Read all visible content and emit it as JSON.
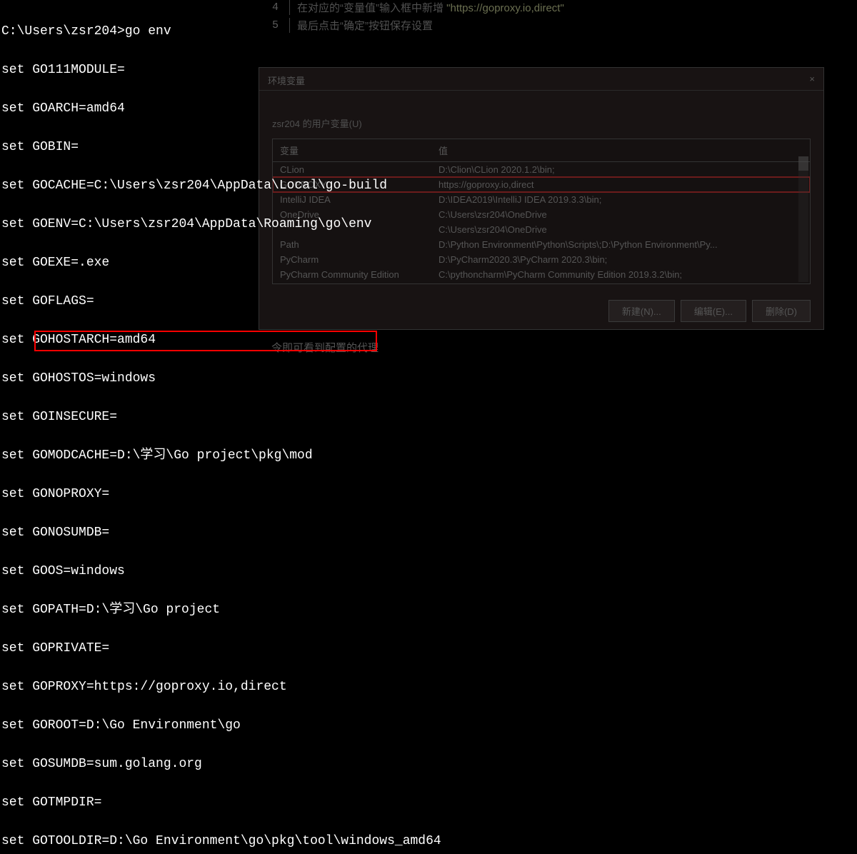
{
  "terminal": {
    "prompt": "C:\\Users\\zsr204>go env",
    "lines": [
      "set GO111MODULE=",
      "set GOARCH=amd64",
      "set GOBIN=",
      "set GOCACHE=C:\\Users\\zsr204\\AppData\\Local\\go-build",
      "set GOENV=C:\\Users\\zsr204\\AppData\\Roaming\\go\\env",
      "set GOEXE=.exe",
      "set GOFLAGS=",
      "set GOHOSTARCH=amd64",
      "set GOHOSTOS=windows",
      "set GOINSECURE=",
      "set GOMODCACHE=D:\\学习\\Go project\\pkg\\mod",
      "set GONOPROXY=",
      "set GONOSUMDB=",
      "set GOOS=windows",
      "set GOPATH=D:\\学习\\Go project",
      "set GOPRIVATE=",
      "set GOPROXY=https://goproxy.io,direct",
      "set GOROOT=D:\\Go Environment\\go",
      "set GOSUMDB=sum.golang.org",
      "set GOTMPDIR=",
      "set GOTOOLDIR=D:\\Go Environment\\go\\pkg\\tool\\windows_amd64"
    ]
  },
  "bg": {
    "step4num": "4",
    "step4": "在对应的“变量值”输入框中新增 ",
    "step4hl": "\"https://goproxy.io,direct\"",
    "step5num": "5",
    "step5": "最后点击“确定”按钮保存设置",
    "caption": "令即可看到配置的代理"
  },
  "dialog": {
    "title": "环境变量",
    "subtitle": "zsr204 的用户变量(U)",
    "close": "×",
    "headers": {
      "var": "变量",
      "val": "值"
    },
    "rows": [
      {
        "var": "CLion",
        "val": "D:\\Clion\\CLion 2020.1.2\\bin;"
      },
      {
        "var": "GOPROXY",
        "val": "https://goproxy.io,direct"
      },
      {
        "var": "IntelliJ IDEA",
        "val": "D:\\IDEA2019\\IntelliJ IDEA 2019.3.3\\bin;"
      },
      {
        "var": "OneDrive",
        "val": "C:\\Users\\zsr204\\OneDrive"
      },
      {
        "var": "",
        "val": "C:\\Users\\zsr204\\OneDrive"
      },
      {
        "var": "Path",
        "val": "D:\\Python Environment\\Python\\Scripts\\;D:\\Python Environment\\Py..."
      },
      {
        "var": "PyCharm",
        "val": "D:\\PyCharm2020.3\\PyCharm 2020.3\\bin;"
      },
      {
        "var": "PyCharm Community Edition",
        "val": "C:\\pythoncharm\\PyCharm Community Edition 2019.3.2\\bin;"
      }
    ],
    "buttons": {
      "new": "新建(N)...",
      "edit": "编辑(E)...",
      "delete": "删除(D)"
    }
  }
}
